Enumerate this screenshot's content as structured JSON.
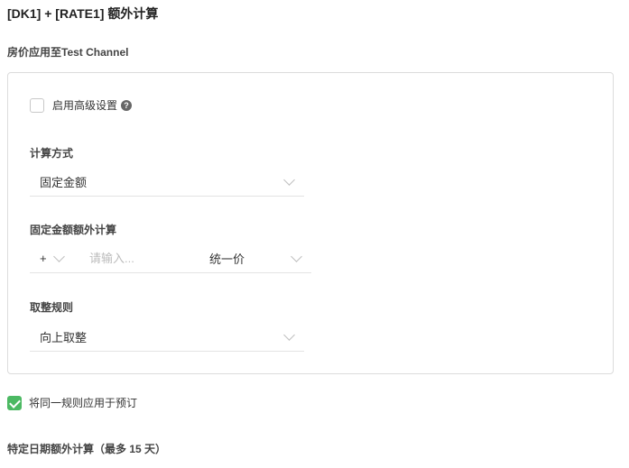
{
  "header": {
    "title": "[DK1] + [RATE1] 额外计算"
  },
  "section": {
    "subtitle": "房价应用至Test Channel"
  },
  "advanced": {
    "label": "启用高级设置",
    "help_icon": "?",
    "checked": false
  },
  "calc_method": {
    "label": "计算方式",
    "value": "固定金额"
  },
  "fixed_amount": {
    "label": "固定金额额外计算",
    "operator": "+",
    "placeholder": "请输入...",
    "value": "",
    "unit": "统一价"
  },
  "rounding": {
    "label": "取整规则",
    "value": "向上取整"
  },
  "apply_booking": {
    "label": "将同一规则应用于预订",
    "checked": true
  },
  "special_dates": {
    "label": "特定日期额外计算（最多 15 天）"
  },
  "colors": {
    "accent": "#4cb963",
    "border": "#dcdcdc"
  }
}
